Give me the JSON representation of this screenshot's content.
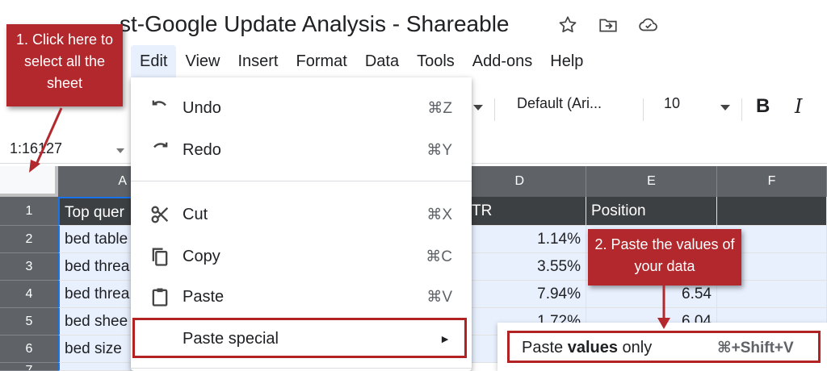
{
  "document": {
    "title": "st-Google Update Analysis - Shareable"
  },
  "menubar": [
    "Edit",
    "View",
    "Insert",
    "Format",
    "Data",
    "Tools",
    "Add-ons",
    "Help"
  ],
  "toolbar": {
    "font": "Default (Ari...",
    "font_size": "10",
    "bold": "B",
    "italic": "I"
  },
  "formula_bar": {
    "name_box": "1:16127"
  },
  "columns": [
    "A",
    "D",
    "E",
    "F"
  ],
  "rows": [
    "1",
    "2",
    "3",
    "4",
    "5",
    "6",
    "7"
  ],
  "cells": {
    "a": [
      "Top quer",
      "bed table",
      "bed threa",
      "bed threa",
      "bed shee",
      "bed size"
    ],
    "c": [
      "TR"
    ],
    "d": [
      "1.14%",
      "3.55%",
      "7.94%",
      "1.72%"
    ],
    "e": [
      "Position",
      "6.54",
      "6.04"
    ]
  },
  "edit_menu": {
    "undo": {
      "label": "Undo",
      "shortcut": "⌘Z"
    },
    "redo": {
      "label": "Redo",
      "shortcut": "⌘Y"
    },
    "cut": {
      "label": "Cut",
      "shortcut": "⌘X"
    },
    "copy": {
      "label": "Copy",
      "shortcut": "⌘C"
    },
    "paste": {
      "label": "Paste",
      "shortcut": "⌘V"
    },
    "paste_special": {
      "label": "Paste special",
      "arrow": "►"
    }
  },
  "submenu": {
    "paste_values_prefix": "Paste ",
    "paste_values_bold": "values",
    "paste_values_suffix": " only",
    "paste_values_shortcut": "⌘+Shift+V"
  },
  "callouts": {
    "step1": "1. Click here to select all the sheet",
    "step2": "2. Paste the values of your data"
  },
  "colors": {
    "callout": "#b3282d",
    "highlight_border": "#b22222",
    "header_dark": "#5f6368",
    "selection": "#e8f0fe"
  }
}
